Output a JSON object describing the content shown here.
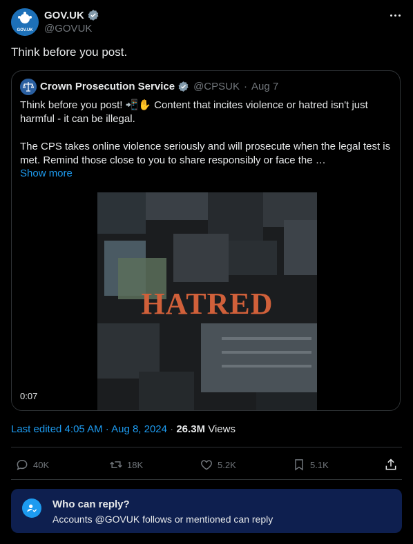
{
  "author": {
    "name": "GOV.UK",
    "handle": "@GOVUK",
    "avatar_label": "GOV.UK",
    "verified": true
  },
  "tweet": {
    "text": "Think before you post."
  },
  "quote": {
    "name": "Crown Prosecution Service",
    "handle": "@CPSUK",
    "separator": "·",
    "date": "Aug 7",
    "paragraph1": "Think before you post! 📲✋ Content that incites violence or hatred isn't just harmful - it can be illegal.",
    "paragraph2": "The CPS takes online violence seriously and will prosecute when the legal test is met. Remind those close to you to share responsibly or face the …",
    "show_more": "Show more",
    "media": {
      "overlay_text": "HATRED",
      "duration": "0:07",
      "overlay_color": "#d0603a"
    }
  },
  "meta": {
    "edited": "Last edited 4:05 AM · Aug 8, 2024",
    "separator": "·",
    "views_count": "26.3M",
    "views_label": "Views"
  },
  "actions": {
    "replies": "40K",
    "reposts": "18K",
    "likes": "5.2K",
    "bookmarks": "5.1K"
  },
  "reply_settings": {
    "title": "Who can reply?",
    "subtitle": "Accounts @GOVUK follows or mentioned can reply"
  },
  "colors": {
    "background": "#000000",
    "accent": "#1d9bf0",
    "muted": "#71767b",
    "reply_box": "#0e1f4f"
  }
}
